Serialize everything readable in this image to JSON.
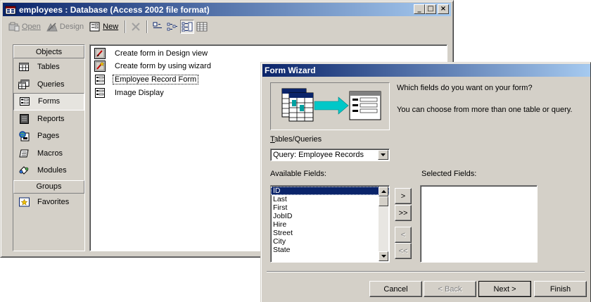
{
  "db_window": {
    "title": "employees : Database (Access 2002 file format)",
    "controls": {
      "minimize": "_",
      "maximize": "□",
      "close": "×"
    },
    "toolbar": {
      "open_label": "Open",
      "design_label": "Design",
      "new_label": "New"
    },
    "objects_header": "Objects",
    "groups_header": "Groups",
    "objects": [
      {
        "label": "Tables",
        "icon": "table-icon"
      },
      {
        "label": "Queries",
        "icon": "query-icon"
      },
      {
        "label": "Forms",
        "icon": "form-icon",
        "selected": true
      },
      {
        "label": "Reports",
        "icon": "report-icon"
      },
      {
        "label": "Pages",
        "icon": "page-icon"
      },
      {
        "label": "Macros",
        "icon": "macro-icon"
      },
      {
        "label": "Modules",
        "icon": "module-icon"
      }
    ],
    "groups": [
      {
        "label": "Favorites",
        "icon": "favorites-icon"
      }
    ],
    "list_items": [
      "Create form in Design view",
      "Create form by using wizard",
      "Employee Record Form",
      "Image Display"
    ]
  },
  "wizard": {
    "title": "Form Wizard",
    "question": "Which fields do you want on your form?",
    "hint": "You can choose from more than one table or query.",
    "tables_queries_label": "Tables/Queries",
    "tables_queries_value": "Query: Employee Records",
    "available_label": "Available Fields:",
    "selected_label": "Selected Fields:",
    "available_fields": [
      "ID",
      "Last",
      "First",
      "JobID",
      "Hire",
      "Street",
      "City",
      "State"
    ],
    "selected_fields": [],
    "move_buttons": {
      "add_one": ">",
      "add_all": ">>",
      "remove_one": "<",
      "remove_all": "<<"
    },
    "buttons": {
      "cancel": "Cancel",
      "back": "< Back",
      "next": "Next >",
      "finish": "Finish"
    }
  },
  "colors": {
    "title_active_start": "#0a246a",
    "title_active_end": "#a6caf0",
    "face": "#d4d0c8",
    "selection": "#0a246a"
  }
}
